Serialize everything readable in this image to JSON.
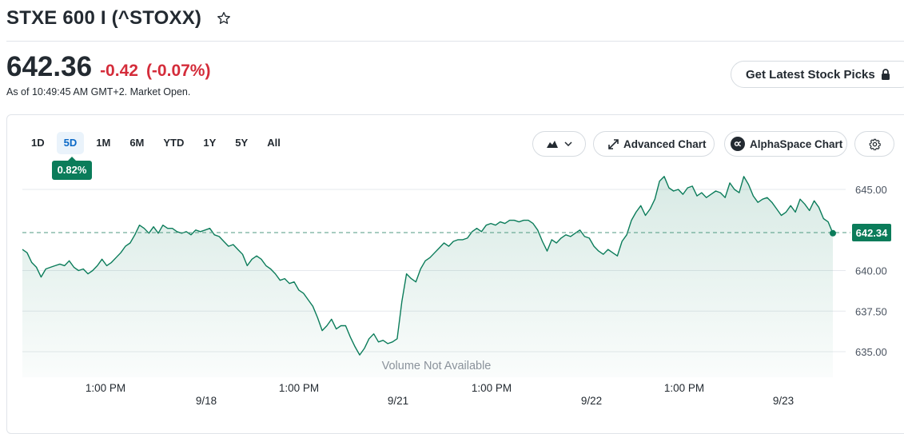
{
  "header": {
    "title": "STXE 600 I (^STOXX)"
  },
  "quote": {
    "price": "642.36",
    "change": "-0.42",
    "change_pct": "(-0.07%)",
    "as_of": "As of 10:49:45 AM GMT+2. Market Open."
  },
  "actions": {
    "picks_label": "Get Latest Stock Picks"
  },
  "toolbar": {
    "ranges": [
      "1D",
      "5D",
      "1M",
      "6M",
      "YTD",
      "1Y",
      "5Y",
      "All"
    ],
    "active_range": "5D",
    "range_change": "0.82%",
    "advanced_chart": "Advanced Chart",
    "alphaspace_chart": "AlphaSpace Chart"
  },
  "colors": {
    "accent_green": "#0b7c5a",
    "negative_red": "#d42c3a",
    "line_green": "#0b7c5a"
  },
  "chart_data": {
    "type": "area",
    "title": "",
    "ylim": [
      633.5,
      646.8
    ],
    "y_ticks": [
      "645.00",
      "640.00",
      "637.50",
      "635.00"
    ],
    "x_labels": [
      "1:00 PM",
      "9/18",
      "1:00 PM",
      "9/21",
      "1:00 PM",
      "9/22",
      "1:00 PM",
      "9/23"
    ],
    "reference_value": 642.34,
    "last_value_label": "642.34",
    "volume_note": "Volume Not Available",
    "values": [
      641.3,
      641.1,
      640.5,
      640.2,
      639.6,
      640.1,
      640.2,
      640.3,
      640.4,
      640.3,
      640.6,
      640.2,
      640.0,
      640.1,
      639.8,
      640.0,
      640.3,
      640.7,
      640.3,
      640.5,
      640.8,
      641.1,
      641.5,
      641.7,
      642.2,
      642.8,
      642.6,
      642.3,
      642.7,
      642.3,
      642.8,
      642.6,
      642.6,
      642.4,
      642.3,
      642.4,
      642.2,
      642.5,
      642.4,
      642.5,
      642.6,
      642.2,
      642.1,
      641.8,
      641.5,
      641.6,
      641.3,
      641.0,
      640.3,
      640.7,
      640.9,
      640.7,
      640.3,
      640.1,
      639.8,
      639.4,
      639.5,
      639.2,
      639.3,
      638.8,
      638.6,
      638.2,
      637.8,
      637.1,
      636.3,
      636.6,
      637.0,
      636.4,
      636.6,
      636.6,
      635.9,
      635.3,
      634.8,
      635.2,
      635.8,
      636.1,
      635.6,
      635.7,
      635.5,
      635.6,
      635.8,
      638.1,
      639.8,
      639.5,
      639.3,
      640.1,
      640.6,
      640.8,
      641.1,
      641.4,
      641.7,
      641.5,
      641.8,
      641.9,
      641.9,
      642.0,
      642.4,
      642.6,
      642.4,
      642.8,
      642.9,
      642.8,
      643.0,
      642.9,
      643.1,
      643.1,
      643.0,
      643.1,
      643.1,
      642.9,
      642.5,
      641.8,
      641.2,
      641.9,
      641.7,
      642.0,
      642.2,
      642.1,
      642.3,
      642.5,
      642.1,
      642.0,
      641.5,
      641.2,
      641.0,
      641.3,
      641.1,
      640.9,
      641.8,
      642.2,
      643.1,
      643.6,
      644.0,
      643.4,
      643.8,
      644.4,
      645.5,
      645.8,
      645.1,
      644.9,
      645.0,
      644.7,
      645.1,
      645.2,
      644.6,
      644.8,
      644.5,
      644.7,
      644.9,
      644.8,
      644.5,
      645.4,
      645.0,
      644.8,
      645.8,
      645.3,
      644.6,
      644.2,
      644.4,
      644.5,
      644.2,
      643.8,
      643.4,
      643.6,
      644.0,
      643.6,
      644.4,
      644.1,
      643.7,
      644.3,
      643.9,
      643.2,
      643.0,
      642.3
    ]
  }
}
